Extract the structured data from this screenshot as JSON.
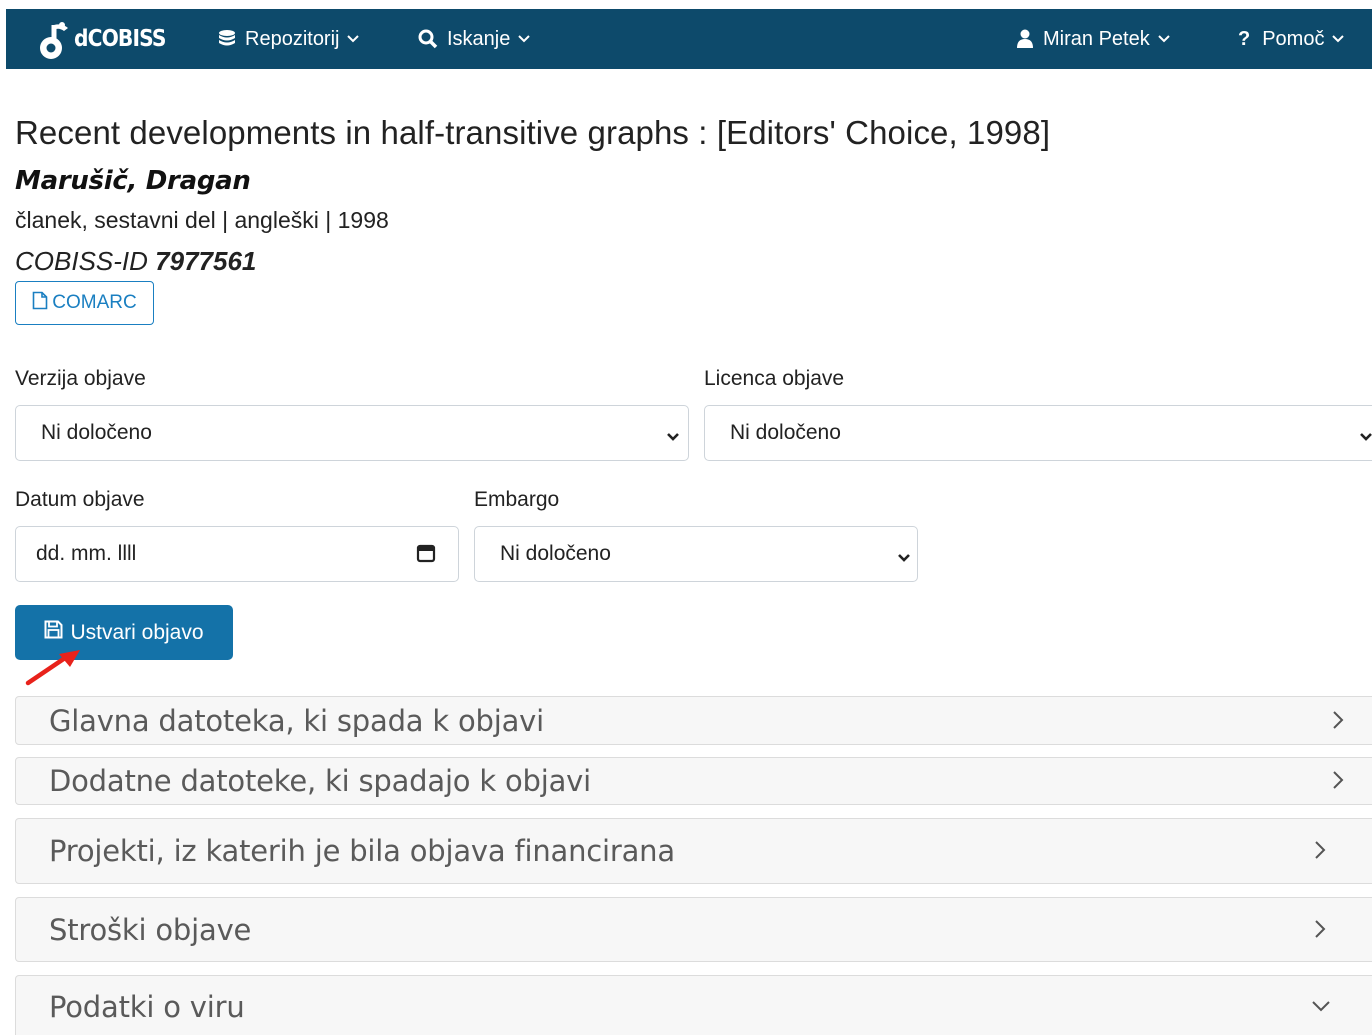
{
  "nav": {
    "brand": "dCOBISS",
    "repository": "Repozitorij",
    "search": "Iskanje",
    "user": "Miran Petek",
    "help": "Pomoč",
    "accent_color": "#0d4a6b"
  },
  "record": {
    "title": "Recent developments in half-transitive graphs : [Editors' Choice, 1998]",
    "author": "Marušič, Dragan",
    "meta": "članek, sestavni del | angleški | 1998",
    "cobiss_label": "COBISS-ID",
    "cobiss_id": "7977561",
    "comarc_label": "COMARC"
  },
  "form": {
    "version_label": "Verzija objave",
    "version_value": "Ni določeno",
    "license_label": "Licenca objave",
    "license_value": "Ni določeno",
    "date_label": "Datum objave",
    "date_placeholder": "dd. mm. llll",
    "embargo_label": "Embargo",
    "embargo_value": "Ni določeno",
    "create_label": "Ustvari objavo"
  },
  "sections": [
    {
      "title": "Glavna datoteka, ki spada k objavi",
      "state": "collapsed"
    },
    {
      "title": "Dodatne datoteke, ki spadajo k objavi",
      "state": "collapsed"
    },
    {
      "title": "Projekti, iz katerih je bila objava financirana",
      "state": "collapsed"
    },
    {
      "title": "Stroški objave",
      "state": "collapsed"
    },
    {
      "title": "Podatki o viru",
      "state": "expanded"
    }
  ]
}
